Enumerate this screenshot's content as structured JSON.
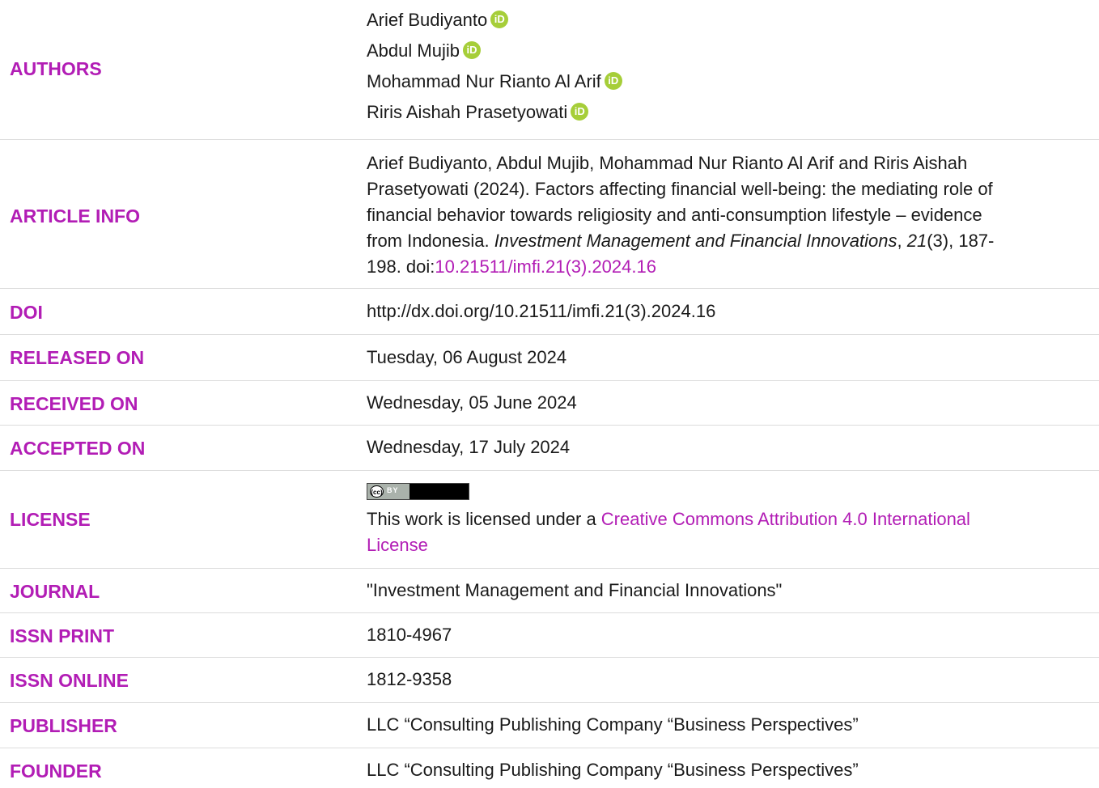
{
  "rows": {
    "authors": {
      "label": "AUTHORS",
      "names": [
        "Arief Budiyanto",
        "Abdul Mujib",
        "Mohammad Nur Rianto Al Arif",
        "Riris Aishah Prasetyowati"
      ],
      "orcid_icon": "orcid-icon",
      "orcid_glyph": "iD",
      "orcid_color": "#a6ce39"
    },
    "article_info": {
      "label": "ARTICLE INFO",
      "line1": "Arief Budiyanto, Abdul Mujib, Mohammad Nur Rianto Al Arif and Riris Aishah",
      "line2": "Prasetyowati (2024). Factors affecting financial well-being: the mediating role of",
      "line3": "financial behavior towards religiosity and anti-consumption lifestyle – evidence",
      "line4_pre": "from Indonesia. ",
      "line4_journal": "Investment Management and Financial Innovations",
      "line4_sep": ", ",
      "line4_volume": "21",
      "line4_post": "(3), 187-",
      "line5_pre": "198. doi:",
      "line5_doi": "10.21511/imfi.21(3).2024.16"
    },
    "doi": {
      "label": "DOI",
      "value": "http://dx.doi.org/10.21511/imfi.21(3).2024.16"
    },
    "released_on": {
      "label": "RELEASED ON",
      "value": "Tuesday, 06 August 2024"
    },
    "received_on": {
      "label": "RECEIVED ON",
      "value": "Wednesday, 05 June 2024"
    },
    "accepted_on": {
      "label": "ACCEPTED ON",
      "value": "Wednesday, 17 July 2024"
    },
    "license": {
      "label": "LICENSE",
      "badge_cc": "(cc)",
      "badge_by": "BY",
      "text_pre": "This work is licensed under a ",
      "link_line1": "Creative Commons Attribution 4.0 International",
      "link_line2": "License"
    },
    "journal": {
      "label": "JOURNAL",
      "value": "\"Investment Management and Financial Innovations\""
    },
    "issn_print": {
      "label": "ISSN PRINT",
      "value": "1810-4967"
    },
    "issn_online": {
      "label": "ISSN ONLINE",
      "value": "1812-9358"
    },
    "publisher": {
      "label": "PUBLISHER",
      "value": "LLC “Consulting Publishing Company “Business Perspectives”"
    },
    "founder": {
      "label": "FOUNDER",
      "value": "LLC “Consulting Publishing Company “Business Perspectives”"
    }
  },
  "colors": {
    "label": "#b21db5",
    "link": "#b21db5",
    "text": "#1a1a1a",
    "divider": "#dcdcdc"
  }
}
